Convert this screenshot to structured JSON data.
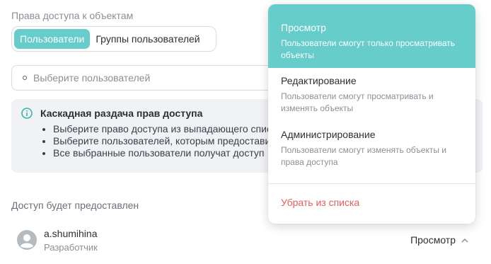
{
  "section_title": "Права доступа к объектам",
  "tabs": [
    {
      "label": "Пользователи",
      "active": true
    },
    {
      "label": "Группы пользователей",
      "active": false
    }
  ],
  "user_select": {
    "placeholder": "Выберите пользователей"
  },
  "info": {
    "heading": "Каскадная раздача прав доступа",
    "items": [
      "Выберите право доступа из выпадающего списка",
      "Выберите пользователей, которым предоставить доступ",
      "Все выбранные пользователи получат доступ"
    ]
  },
  "granted_title": "Доступ будет предоставлен",
  "user": {
    "name": "a.shumihina",
    "role": "Разработчик",
    "access": "Просмотр"
  },
  "dropdown": {
    "options": [
      {
        "title": "Просмотр",
        "desc": "Пользователи смогут только просматривать объекты",
        "selected": true
      },
      {
        "title": "Редактирование",
        "desc": "Пользователи смогут просматривать и изменять объекты",
        "selected": false
      },
      {
        "title": "Администрирование",
        "desc": "Пользователи смогут изменять объекты и права доступа",
        "selected": false
      }
    ],
    "remove_label": "Убрать из списка"
  },
  "colors": {
    "accent": "#66cdcb",
    "danger": "#ef5b5b",
    "info_bg": "#f1f2f5"
  }
}
